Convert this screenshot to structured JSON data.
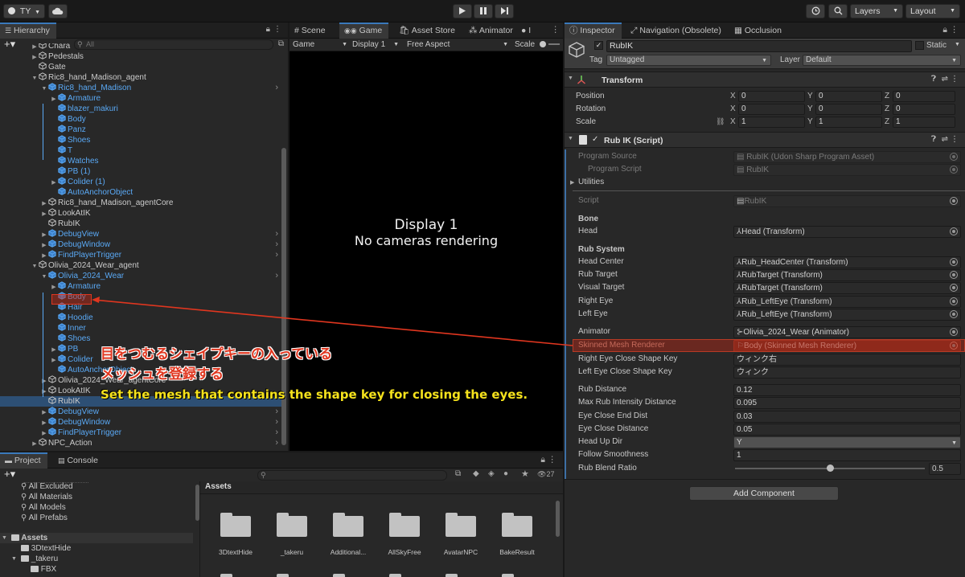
{
  "toolbar": {
    "account": "TY",
    "layers": "Layers",
    "layout": "Layout"
  },
  "hierarchy": {
    "tab": "Hierarchy",
    "search_placeholder": "All",
    "rows": [
      {
        "label": "Chara",
        "indent": 2,
        "expand": "right",
        "blue": false
      },
      {
        "label": "Pedestals",
        "indent": 2,
        "expand": "right",
        "blue": false
      },
      {
        "label": "Gate",
        "indent": 2,
        "expand": "",
        "blue": false
      },
      {
        "label": "Ric8_hand_Madison_agent",
        "indent": 2,
        "expand": "down",
        "blue": false
      },
      {
        "label": "Ric8_hand_Madison",
        "indent": 3,
        "expand": "down",
        "blue": true,
        "chev": true
      },
      {
        "label": "Armature",
        "indent": 4,
        "expand": "right",
        "blue": true
      },
      {
        "label": "blazer_makuri",
        "indent": 4,
        "expand": "",
        "blue": true
      },
      {
        "label": "Body",
        "indent": 4,
        "expand": "",
        "blue": true
      },
      {
        "label": "Panz",
        "indent": 4,
        "expand": "",
        "blue": true
      },
      {
        "label": "Shoes",
        "indent": 4,
        "expand": "",
        "blue": true
      },
      {
        "label": "T",
        "indent": 4,
        "expand": "",
        "blue": true
      },
      {
        "label": "Watches",
        "indent": 4,
        "expand": "",
        "blue": true
      },
      {
        "label": "PB (1)",
        "indent": 4,
        "expand": "",
        "blue": true
      },
      {
        "label": "Colider (1)",
        "indent": 4,
        "expand": "right",
        "blue": true
      },
      {
        "label": "AutoAnchorObject",
        "indent": 4,
        "expand": "",
        "blue": true
      },
      {
        "label": "Ric8_hand_Madison_agentCore",
        "indent": 3,
        "expand": "right",
        "blue": false
      },
      {
        "label": "LookAtIK",
        "indent": 3,
        "expand": "right",
        "blue": false
      },
      {
        "label": "RubIK",
        "indent": 3,
        "expand": "",
        "blue": false
      },
      {
        "label": "DebugView",
        "indent": 3,
        "expand": "right",
        "blue": true,
        "chev": true
      },
      {
        "label": "DebugWindow",
        "indent": 3,
        "expand": "right",
        "blue": true,
        "chev": true
      },
      {
        "label": "FindPlayerTrigger",
        "indent": 3,
        "expand": "right",
        "blue": true,
        "chev": true
      },
      {
        "label": "Olivia_2024_Wear_agent",
        "indent": 2,
        "expand": "down",
        "blue": false
      },
      {
        "label": "Olivia_2024_Wear",
        "indent": 3,
        "expand": "down",
        "blue": true,
        "chev": true
      },
      {
        "label": "Armature",
        "indent": 4,
        "expand": "right",
        "blue": true
      },
      {
        "label": "Body",
        "indent": 4,
        "expand": "",
        "blue": true,
        "highlight": true
      },
      {
        "label": "Hair",
        "indent": 4,
        "expand": "",
        "blue": true
      },
      {
        "label": "Hoodie",
        "indent": 4,
        "expand": "",
        "blue": true
      },
      {
        "label": "Inner",
        "indent": 4,
        "expand": "",
        "blue": true
      },
      {
        "label": "Shoes",
        "indent": 4,
        "expand": "",
        "blue": true
      },
      {
        "label": "PB",
        "indent": 4,
        "expand": "right",
        "blue": true
      },
      {
        "label": "Colider",
        "indent": 4,
        "expand": "right",
        "blue": true
      },
      {
        "label": "AutoAnchorObject",
        "indent": 4,
        "expand": "",
        "blue": true
      },
      {
        "label": "Olivia_2024_Wear_agentCore",
        "indent": 3,
        "expand": "right",
        "blue": false
      },
      {
        "label": "LookAtIK",
        "indent": 3,
        "expand": "right",
        "blue": false
      },
      {
        "label": "RubIK",
        "indent": 3,
        "expand": "",
        "blue": false,
        "selected": true
      },
      {
        "label": "DebugView",
        "indent": 3,
        "expand": "right",
        "blue": true,
        "chev": true
      },
      {
        "label": "DebugWindow",
        "indent": 3,
        "expand": "right",
        "blue": true,
        "chev": true
      },
      {
        "label": "FindPlayerTrigger",
        "indent": 3,
        "expand": "right",
        "blue": true,
        "chev": true
      },
      {
        "label": "NPC_Action",
        "indent": 2,
        "expand": "right",
        "blue": false,
        "chev": true
      }
    ]
  },
  "center": {
    "tabs": [
      "Scene",
      "Game",
      "Asset Store",
      "Animator",
      "I"
    ],
    "game_dropdown": "Game",
    "display_dropdown": "Display 1",
    "aspect_dropdown": "Free Aspect",
    "scale_label": "Scale",
    "display_title": "Display 1",
    "display_msg": "No cameras rendering"
  },
  "inspector": {
    "tabs": [
      "Inspector",
      "Navigation (Obsolete)",
      "Occlusion"
    ],
    "object_name": "RubIK",
    "static_label": "Static",
    "tag_label": "Tag",
    "tag_value": "Untagged",
    "layer_label": "Layer",
    "layer_value": "Default",
    "transform": {
      "title": "Transform",
      "position_label": "Position",
      "rotation_label": "Rotation",
      "scale_label": "Scale",
      "position": [
        "0",
        "0",
        "0"
      ],
      "rotation": [
        "0",
        "0",
        "0"
      ],
      "scale": [
        "1",
        "1",
        "1"
      ],
      "axes": [
        "X",
        "Y",
        "Z"
      ]
    },
    "script": {
      "title": "Rub IK (Script)",
      "program_source_label": "Program Source",
      "program_source_value": "RubIK (Udon Sharp Program Asset)",
      "program_script_label": "Program Script",
      "program_script_value": "RubIK",
      "utilities_label": "Utilities",
      "script_label": "Script",
      "script_value": "RubIK",
      "bone_header": "Bone",
      "head_label": "Head",
      "head_value": "Head (Transform)",
      "rub_header": "Rub System",
      "head_center_label": "Head Center",
      "head_center_value": "Rub_HeadCenter (Transform)",
      "rub_target_label": "Rub Target",
      "rub_target_value": "RubTarget (Transform)",
      "visual_target_label": "Visual Target",
      "visual_target_value": "RubTarget (Transform)",
      "right_eye_label": "Right Eye",
      "right_eye_value": "Rub_LeftEye (Transform)",
      "left_eye_label": "Left Eye",
      "left_eye_value": "Rub_LeftEye (Transform)",
      "animator_label": "Animator",
      "animator_value": "Olivia_2024_Wear (Animator)",
      "smr_label": "Skinned Mesh Renderer",
      "smr_value": "Body (Skinned Mesh Renderer)",
      "right_key_label": "Right Eye Close Shape Key",
      "right_key_value": "ウィンク右",
      "left_key_label": "Left Eye Close Shape Key",
      "left_key_value": "ウィンク",
      "rub_distance_label": "Rub Distance",
      "rub_distance_value": "0.12",
      "max_rub_label": "Max Rub Intensity Distance",
      "max_rub_value": "0.095",
      "eye_end_label": "Eye Close End Dist",
      "eye_end_value": "0.03",
      "eye_close_label": "Eye Close Distance",
      "eye_close_value": "0.05",
      "head_up_label": "Head Up Dir",
      "head_up_value": "Y",
      "follow_label": "Follow Smoothness",
      "follow_value": "1",
      "blend_label": "Rub Blend Ratio",
      "blend_value": "0.5",
      "blend_fraction": 0.5
    },
    "add_component": "Add Component"
  },
  "project": {
    "tabs": [
      "Project",
      "Console"
    ],
    "count": "27",
    "tree": [
      {
        "label": "All Excluded",
        "indent": 1,
        "kind": "search"
      },
      {
        "label": "All Materials",
        "indent": 1,
        "kind": "search"
      },
      {
        "label": "All Models",
        "indent": 1,
        "kind": "search"
      },
      {
        "label": "All Prefabs",
        "indent": 1,
        "kind": "search"
      },
      {
        "label": "Assets",
        "indent": 0,
        "kind": "folder-root",
        "bold": true
      },
      {
        "label": "3DtextHide",
        "indent": 1,
        "kind": "folder"
      },
      {
        "label": "_takeru",
        "indent": 1,
        "kind": "folder-open"
      },
      {
        "label": "FBX",
        "indent": 2,
        "kind": "folder"
      }
    ],
    "breadcrumb": "Assets",
    "assets": [
      "3DtextHide",
      "_takeru",
      "Additional...",
      "AllSkyFree",
      "AvatarNPC",
      "BakeResult"
    ]
  },
  "annotation": {
    "jp_line1": "目をつむるシェイプキーの入っている",
    "jp_line2": "メッシュを登録する",
    "en": "Set the mesh that contains the shape key for closing the eyes.",
    "color_red": "#e0361f",
    "color_yellow": "#f5e21c"
  }
}
